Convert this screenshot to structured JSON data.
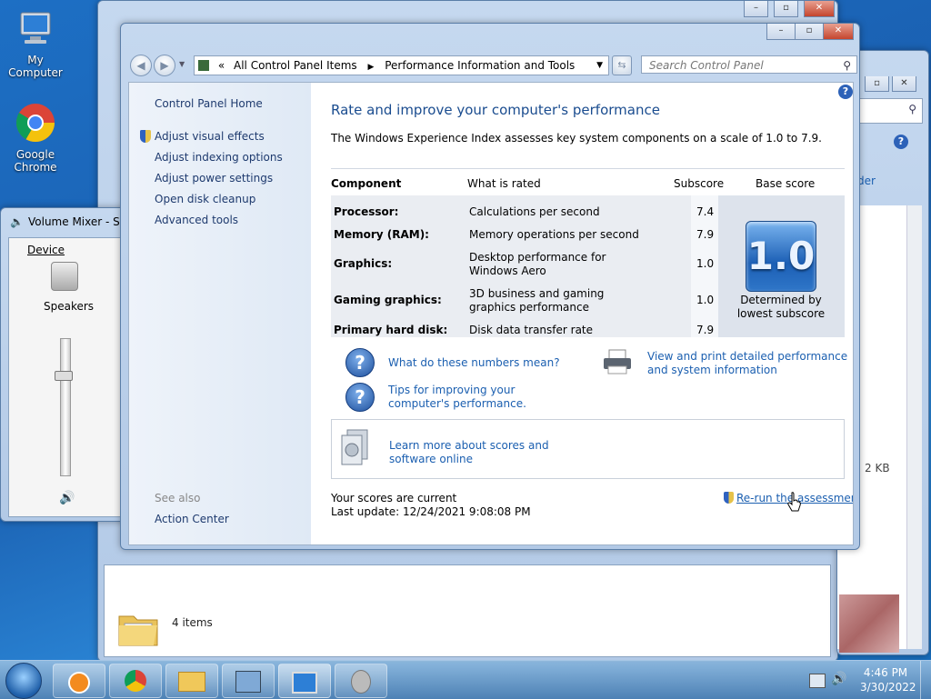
{
  "desktop": {
    "icons": [
      {
        "label": "My Computer"
      },
      {
        "label": "Google Chrome"
      }
    ]
  },
  "volume_mixer": {
    "title": "Volume Mixer - Spe",
    "device_label": "Device",
    "speakers_label": "Speakers"
  },
  "background_window": {
    "status_items": "4 items",
    "size_text": "2 KB",
    "toolbar_text": "der"
  },
  "main_window": {
    "breadcrumb": [
      "All Control Panel Items",
      "Performance Information and Tools"
    ],
    "breadcrumb_prefix": "«",
    "search_placeholder": "Search Control Panel",
    "left_pane": {
      "home": "Control Panel Home",
      "links": [
        "Adjust visual effects",
        "Adjust indexing options",
        "Adjust power settings",
        "Open disk cleanup",
        "Advanced tools"
      ],
      "see_also": "See also",
      "action_center": "Action Center"
    },
    "heading": "Rate and improve your computer's performance",
    "description": "The Windows Experience Index assesses key system components on a scale of 1.0 to 7.9.",
    "table": {
      "headers": [
        "Component",
        "What is rated",
        "Subscore",
        "Base score"
      ],
      "rows": [
        {
          "component": "Processor:",
          "rated": "Calculations per second",
          "subscore": "7.4"
        },
        {
          "component": "Memory (RAM):",
          "rated": "Memory operations per second",
          "subscore": "7.9"
        },
        {
          "component": "Graphics:",
          "rated": "Desktop performance for Windows Aero",
          "subscore": "1.0"
        },
        {
          "component": "Gaming graphics:",
          "rated": "3D business and gaming graphics performance",
          "subscore": "1.0"
        },
        {
          "component": "Primary hard disk:",
          "rated": "Disk data transfer rate",
          "subscore": "7.9"
        }
      ],
      "base_score": "1.0",
      "base_caption": "Determined by lowest subscore"
    },
    "help_links": {
      "what_mean": "What do these numbers mean?",
      "tips": "Tips for improving your computer's performance.",
      "view_print": "View and print detailed performance and system information",
      "learn_more": "Learn more about scores and software online"
    },
    "status": {
      "current": "Your scores are current",
      "last_update": "Last update: 12/24/2021 9:08:08 PM",
      "rerun": "Re-run the assessment"
    }
  },
  "taskbar": {
    "time": "4:46 PM",
    "date": "3/30/2022"
  }
}
